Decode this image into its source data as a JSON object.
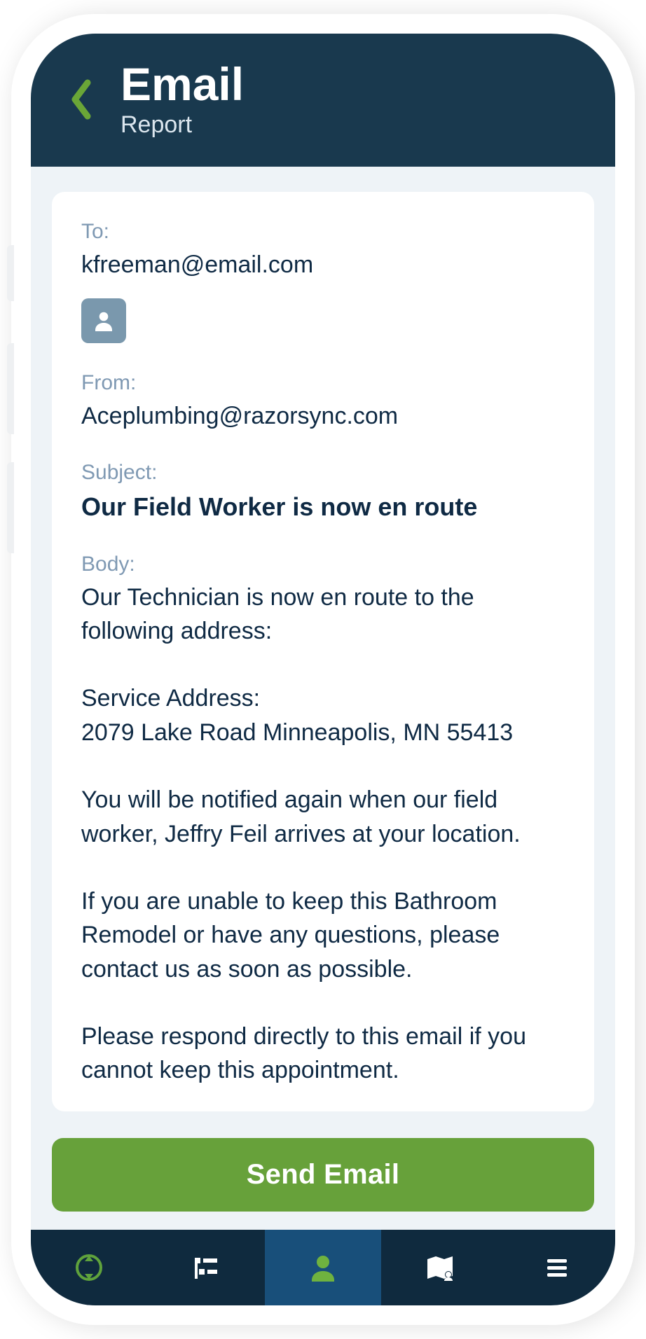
{
  "header": {
    "title": "Email",
    "subtitle": "Report"
  },
  "email": {
    "to_label": "To:",
    "to_value": "kfreeman@email.com",
    "from_label": "From:",
    "from_value": "Aceplumbing@razorsync.com",
    "subject_label": "Subject:",
    "subject_value": "Our Field Worker is now en route",
    "body_label": "Body:",
    "body_value": "Our Technician is now en route to the following address:\n\nService Address:\n2079 Lake Road Minneapolis, MN 55413\n\nYou will be notified again when our field worker, Jeffry Feil arrives at your location.\n\nIf you are unable to keep this Bathroom Remodel or have any questions, please contact us as soon as possible.\n\nPlease respond directly to this email if you cannot keep this appointment."
  },
  "actions": {
    "send_label": "Send Email"
  },
  "nav": {
    "items": [
      "sync",
      "tasks",
      "profile",
      "map",
      "menu"
    ],
    "active_index": 2
  },
  "colors": {
    "header_bg": "#19394e",
    "accent_green": "#67a13a",
    "nav_bg": "#0f2a3e",
    "nav_active_bg": "#184f7a",
    "label_muted": "#7f99b3",
    "text_primary": "#0f2a44",
    "contact_btn": "#7a98ad",
    "body_bg": "#eef3f7"
  }
}
